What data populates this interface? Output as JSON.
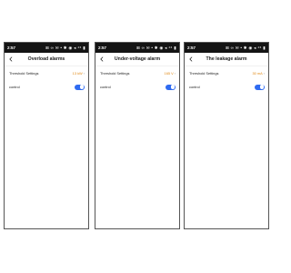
{
  "screens": [
    {
      "status": {
        "time": "2:57",
        "icons": "⊞ ∞ ✉ • ✱ ◉ ◂ ⁴⁶ ▮"
      },
      "title": "Overload alarms",
      "threshold": {
        "label": "Threshold Settings",
        "value": "13 kW"
      },
      "control": {
        "label": "control",
        "enabled": true
      }
    },
    {
      "status": {
        "time": "2:57",
        "icons": "⊞ ∞ ✉ • ✱ ◉ ◂ ⁴⁶ ▮"
      },
      "title": "Under-voltage alarm",
      "threshold": {
        "label": "Threshold Settings",
        "value": "165 V"
      },
      "control": {
        "label": "control",
        "enabled": true
      }
    },
    {
      "status": {
        "time": "2:57",
        "icons": "⊞ ∞ ✉ • ✱ ◉ ◂ ⁴⁶ ▮"
      },
      "title": "The leakage alarm",
      "threshold": {
        "label": "Threshold Settings",
        "value": "30 mA"
      },
      "control": {
        "label": "control",
        "enabled": true
      }
    }
  ],
  "colors": {
    "statusbar": "#141414",
    "threshold_value": "#e08a16",
    "toggle_on": "#2f6bf1"
  },
  "icons": {
    "back": "chevron-left-icon",
    "next": "chevron-right-icon"
  }
}
